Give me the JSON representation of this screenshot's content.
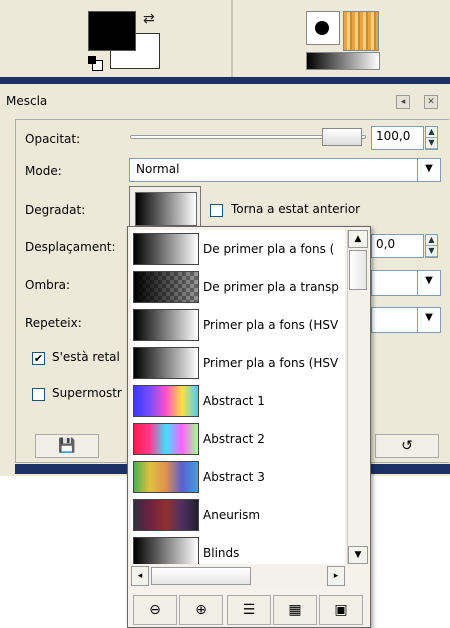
{
  "panel": {
    "title": "Mescla"
  },
  "fields": {
    "opacity_label": "Opacitat:",
    "opacity_value": "100,0",
    "mode_label": "Mode:",
    "mode_value": "Normal",
    "gradient_label": "Degradat:",
    "reverse_label": "Torna a estat anterior",
    "offset_label": "Desplaçament:",
    "offset_value": "0,0",
    "shape_label": "Ombra:",
    "repeat_label": "Repeteix:",
    "dither_label": "S'està retal",
    "supersample_label": "Supermostr"
  },
  "gradient_list": [
    {
      "name": "De primer pla a fons (",
      "colors": [
        "#000000",
        "#ffffff"
      ]
    },
    {
      "name": "De primer pla a transp",
      "colors": [
        "#000000",
        "checker"
      ]
    },
    {
      "name": "Primer pla a fons (HSV",
      "colors": [
        "#000000",
        "#ffffff"
      ]
    },
    {
      "name": "Primer pla a fons (HSV",
      "colors": [
        "#000000",
        "#ffffff"
      ]
    },
    {
      "name": "Abstract 1",
      "colors": [
        "#3a3aff",
        "#7b4cff",
        "#ff50c8",
        "#ffe040",
        "#40d0ff"
      ]
    },
    {
      "name": "Abstract 2",
      "colors": [
        "#ff1a4a",
        "#ff3a90",
        "#40e0ff",
        "#ff60ff",
        "#a0ff90"
      ]
    },
    {
      "name": "Abstract 3",
      "colors": [
        "#50b050",
        "#e0c040",
        "#e09050",
        "#5a60d0",
        "#40a0e0"
      ]
    },
    {
      "name": "Aneurism",
      "colors": [
        "#303040",
        "#702040",
        "#903030",
        "#503060",
        "#202030"
      ]
    },
    {
      "name": "Blinds",
      "colors": [
        "#000000",
        "#ffffff"
      ]
    }
  ]
}
